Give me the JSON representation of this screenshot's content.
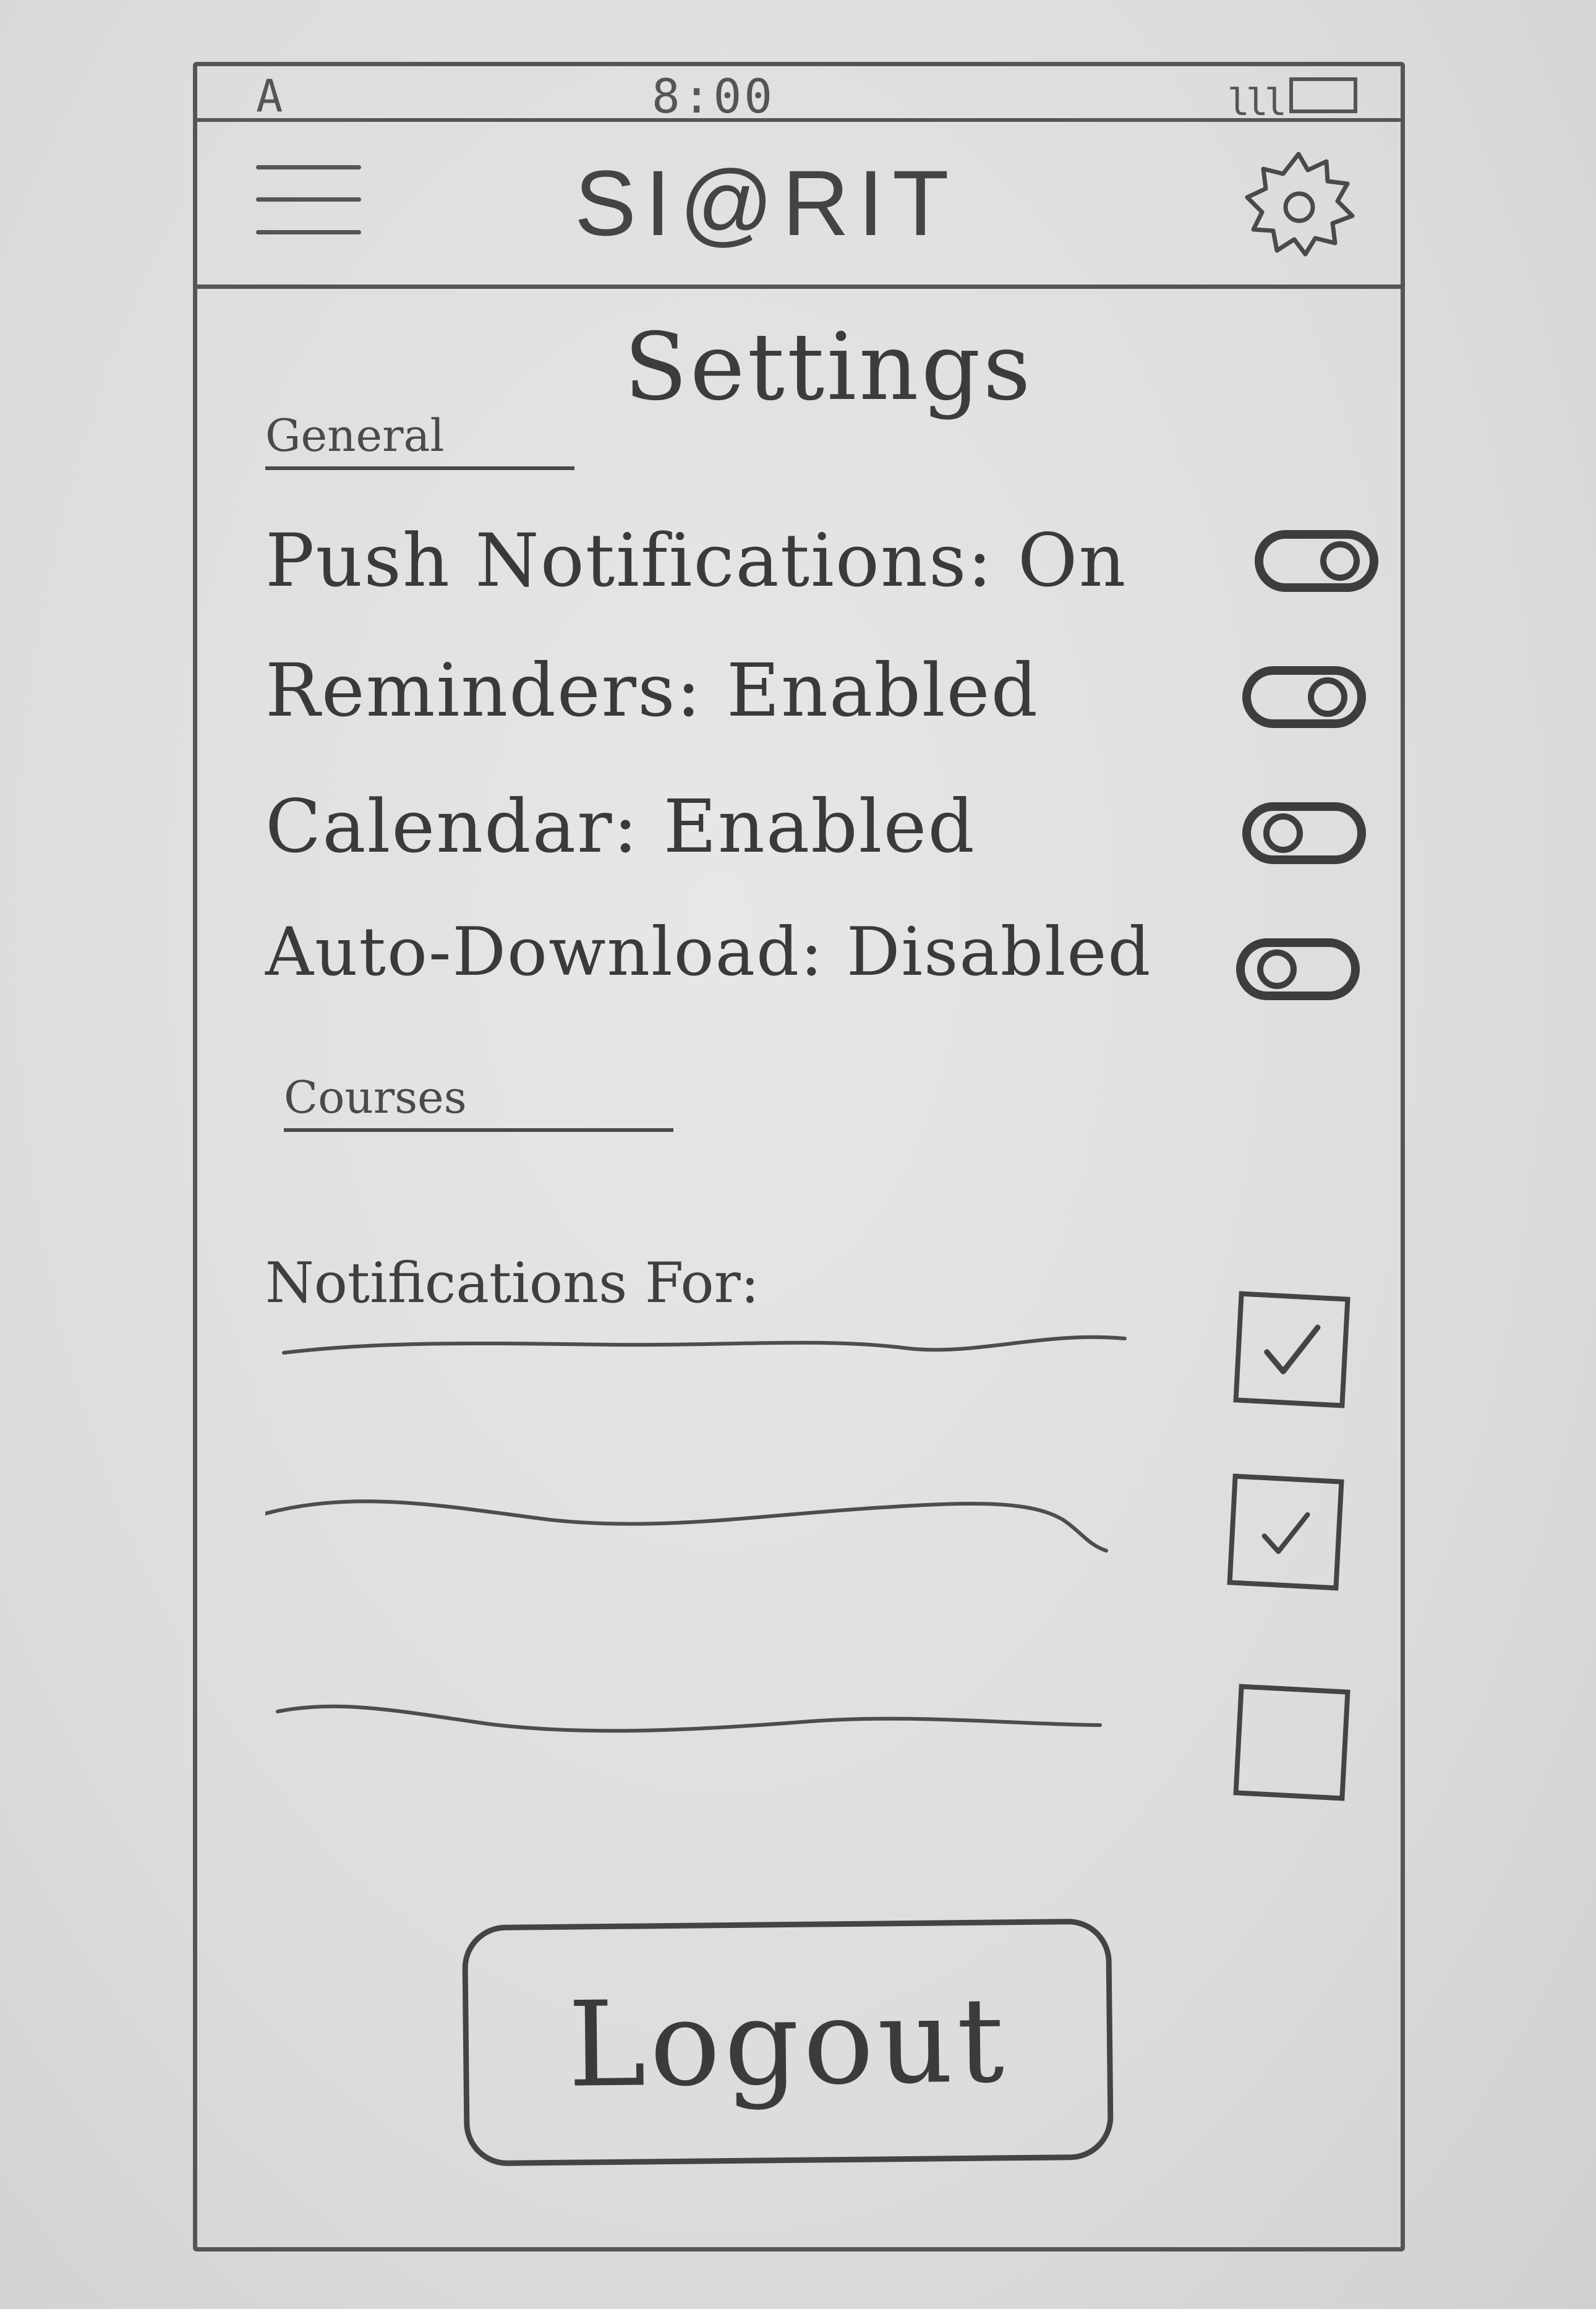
{
  "status_bar": {
    "carrier": "A",
    "time": "8:00",
    "signal": "lll",
    "battery_icon": "battery-icon"
  },
  "header": {
    "menu_icon": "hamburger-menu-icon",
    "title": "SI@RIT",
    "settings_icon": "gear-icon"
  },
  "page": {
    "title": "Settings"
  },
  "general": {
    "label": "General",
    "settings": [
      {
        "text": "Push Notifications: On",
        "toggle": "on"
      },
      {
        "text": "Reminders: Enabled",
        "toggle": "on"
      },
      {
        "text": "Calendar: Enabled",
        "toggle": "on"
      },
      {
        "text": "Auto-Download: Disabled",
        "toggle": "off"
      }
    ]
  },
  "courses": {
    "label": "Courses",
    "notifications_label": "Notifications For:",
    "items": [
      {
        "name": "",
        "checked": true
      },
      {
        "name": "",
        "checked": true
      },
      {
        "name": "",
        "checked": false
      }
    ]
  },
  "logout": {
    "label": "Logout"
  }
}
